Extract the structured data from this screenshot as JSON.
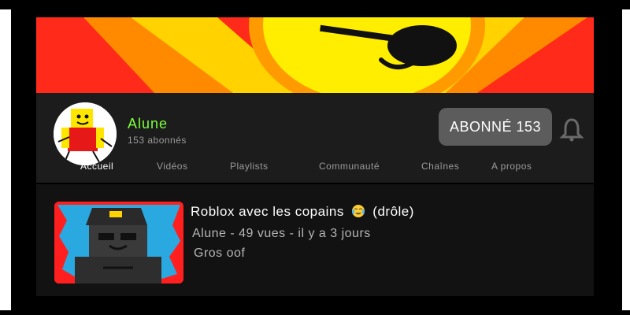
{
  "channel": {
    "name": "Alune",
    "subscribers": "153 abonnés",
    "avatar_icon": "roblox-avatar-icon",
    "banner_icon": "sun-with-sunglasses-icon"
  },
  "subscribe": {
    "label": "ABONNÉ 153",
    "bell_icon": "bell-icon"
  },
  "tabs": [
    {
      "label": "Accueil",
      "active": true
    },
    {
      "label": "Vidéos",
      "active": false
    },
    {
      "label": "Playlists",
      "active": false
    },
    {
      "label": "Communauté",
      "active": false
    },
    {
      "label": "Chaînes",
      "active": false
    },
    {
      "label": "A propos",
      "active": false
    }
  ],
  "video": {
    "title_prefix": "Roblox avec les copains",
    "title_emoji": "crying-laughing-emoji-icon",
    "title_suffix": "(drôle)",
    "meta": "Alune - 49 vues - il y a 3 jours",
    "description": "Gros oof",
    "thumbnail_icon": "roblox-police-character-icon"
  },
  "colors": {
    "channel_name": "#7bff3b",
    "banner_bg": "#ff2a1a",
    "sun": "#ffee00",
    "thumbnail_bg": "#ff1f1f",
    "thumbnail_sky": "#2aa8e0"
  }
}
